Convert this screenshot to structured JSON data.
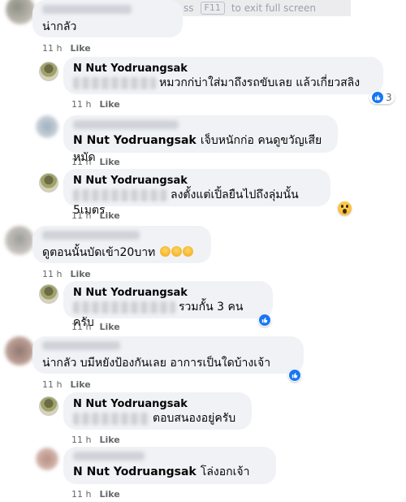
{
  "fullscreen_banner": {
    "prefix": "ss",
    "key": "F11",
    "suffix": "to exit full screen"
  },
  "colors": {
    "bubble": "#f0f2f5",
    "like_blue": "#1877f2",
    "meta": "#65676b"
  },
  "comments": [
    {
      "text": "น่ากลัว",
      "time": "11 h",
      "like": "Like"
    },
    {
      "name": "N Nut Yodruangsak",
      "text": "หมวกก่บ่าใส่มาถึงรถขับเลย แล้วเกี่ยวสลิง",
      "time": "11 h",
      "like": "Like",
      "reaction_count": "3"
    },
    {
      "name": "N Nut Yodruangsak",
      "text": "เจ็บหนักก่อ คนดูขวัญเสียหมัด",
      "time": "11 h",
      "like": "Like"
    },
    {
      "name": "N Nut Yodruangsak",
      "text": "ลงตั้งแต่เปิ้ลยืนไปถึงลุ่มนั้น 5เมตร",
      "time": "11 h",
      "like": "Like"
    },
    {
      "text": "ดูตอนนั้นบัดเข้า20บาท",
      "time": "11 h",
      "like": "Like"
    },
    {
      "name": "N Nut Yodruangsak",
      "text": "รวมกั้น 3 คนครับ",
      "time": "11 h",
      "like": "Like"
    },
    {
      "text": "น่ากลัว บมีหยังป้องกันเลย อาการเป็นใดบ้างเจ้า",
      "time": "11 h",
      "like": "Like"
    },
    {
      "name": "N Nut Yodruangsak",
      "text": "ตอบสนองอยู่ครับ",
      "time": "11 h",
      "like": "Like"
    },
    {
      "name": "N Nut Yodruangsak",
      "text": "โล่งอกเจ้า",
      "time": "11 h",
      "like": "Like"
    }
  ]
}
